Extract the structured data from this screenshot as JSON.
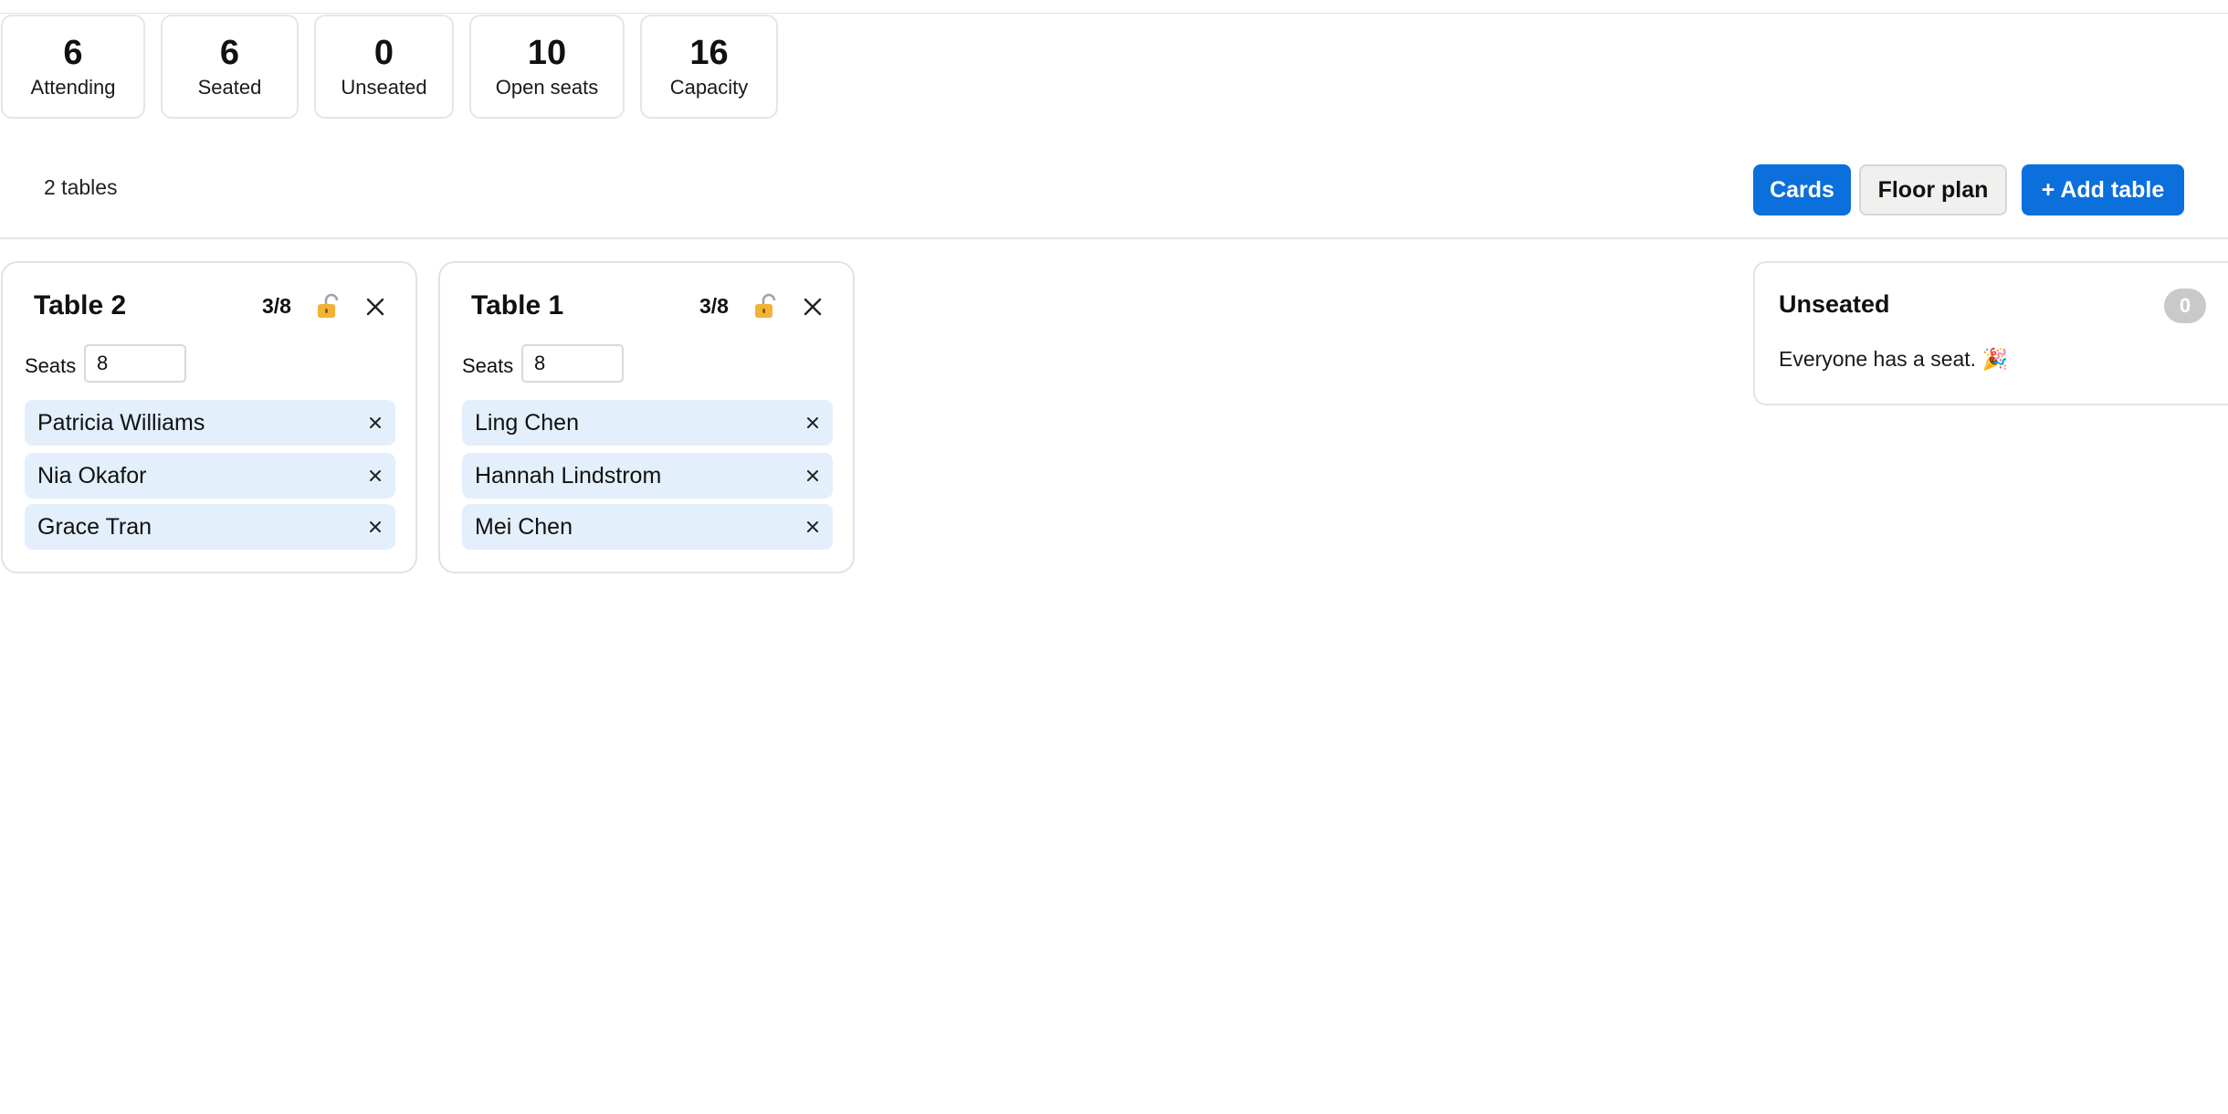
{
  "stats": [
    {
      "value": "6",
      "label": "Attending"
    },
    {
      "value": "6",
      "label": "Seated"
    },
    {
      "value": "0",
      "label": "Unseated"
    },
    {
      "value": "10",
      "label": "Open seats"
    },
    {
      "value": "16",
      "label": "Capacity"
    }
  ],
  "toolbar": {
    "tables_count": "2 tables",
    "cards_label": "Cards",
    "floor_plan_label": "Floor plan",
    "add_table_label": "+ Add table"
  },
  "seats_label": "Seats",
  "tables": [
    {
      "name": "Table 2",
      "count": "3/8",
      "seats": "8",
      "guests": [
        "Patricia Williams",
        "Nia Okafor",
        "Grace Tran"
      ]
    },
    {
      "name": "Table 1",
      "count": "3/8",
      "seats": "8",
      "guests": [
        "Ling Chen",
        "Hannah Lindstrom",
        "Mei Chen"
      ]
    }
  ],
  "unseated": {
    "title": "Unseated",
    "count": "0",
    "message": "Everyone has a seat. 🎉"
  },
  "colors": {
    "primary": "#0b6fdc",
    "guest_chip": "#e3effb",
    "badge": "#c9c9c9"
  },
  "icons": {
    "lock": "lock-icon",
    "close": "close-icon",
    "remove": "remove-guest-icon"
  }
}
